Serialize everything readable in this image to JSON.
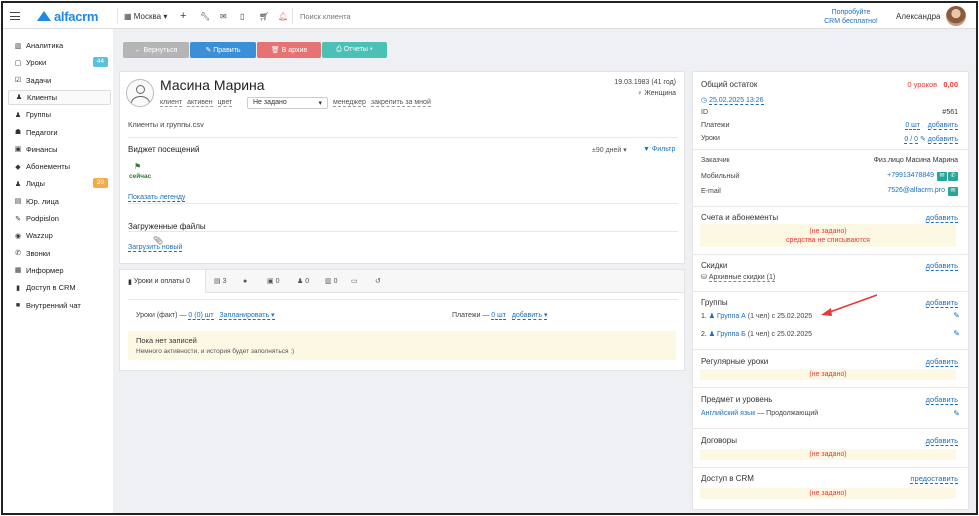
{
  "topbar": {
    "logo": "alfacrm",
    "city": "Москва",
    "search_placeholder": "Поиск клиента",
    "promo_line1": "Попробуйте",
    "promo_line2": "CRM бесплатно!",
    "user_name": "Александра"
  },
  "sidebar": {
    "items": [
      {
        "label": "Аналитика",
        "icon": "chart-icon"
      },
      {
        "label": "Уроки",
        "icon": "calendar-icon",
        "badge": "44",
        "badge_color": "#5bc0de"
      },
      {
        "label": "Задачи",
        "icon": "tasks-icon"
      },
      {
        "label": "Клиенты",
        "icon": "user-icon"
      },
      {
        "label": "Группы",
        "icon": "users-icon"
      },
      {
        "label": "Педагоги",
        "icon": "teacher-icon"
      },
      {
        "label": "Финансы",
        "icon": "money-icon"
      },
      {
        "label": "Абонементы",
        "icon": "tag-icon"
      },
      {
        "label": "Лиды",
        "icon": "leads-icon",
        "badge": "20",
        "badge_color": "#f0ad4e"
      },
      {
        "label": "Юр. лица",
        "icon": "building-icon"
      },
      {
        "label": "Podpislon",
        "icon": "sign-icon"
      },
      {
        "label": "Wazzup",
        "icon": "whatsapp-icon"
      },
      {
        "label": "Звонки",
        "icon": "phone-icon"
      },
      {
        "label": "Информер",
        "icon": "informer-icon"
      },
      {
        "label": "Доступ в CRM",
        "icon": "lock-icon"
      },
      {
        "label": "Внутренний чат",
        "icon": "chat-icon"
      }
    ]
  },
  "actions": {
    "back": "← Вернуться",
    "edit": "✎ Править",
    "archive": "🗑 В архив",
    "reports": "⎙ Отчеты ▾"
  },
  "client": {
    "name": "Масина Марина",
    "birthdate": "19.03.1983 (41 год)",
    "gender": "♀ Женщина",
    "tag_client": "клиент",
    "tag_active": "активен",
    "tag_color": "цвет",
    "select_value": "Не задано",
    "manager": "менеджер",
    "pin": "закрепить за мной",
    "note": "Клиенты и группы.csv"
  },
  "widget": {
    "title": "Виджет посещений",
    "period": "±90 дней ▾",
    "filter": "Фильтр",
    "now_label": "сейчас",
    "legend_link": "Показать легенду"
  },
  "files": {
    "title": "Загруженные файлы",
    "upload": "Загрузить новый"
  },
  "tabs": {
    "lessons": "Уроки и оплаты 0",
    "t2": "3",
    "t4": "0",
    "t5": "0",
    "t6": "0"
  },
  "lessons_panel": {
    "fact_label": "Уроки (факт) —",
    "fact_value": "0 (0) шт",
    "plan_link": "Запланировать ▾",
    "payments_label": "Платежи —",
    "payments_value": "0 шт",
    "add_link": "добавить ▾",
    "empty_title": "Пока нет записей",
    "empty_sub": "Немного активности, и история будет заполняться :)"
  },
  "right": {
    "balance_label": "Общий остаток",
    "balance_value": "0 уроков",
    "balance_money": "0,00",
    "date_link": "25.02.2025 13:26",
    "id_label": "ID",
    "id_value": "#561",
    "payments_label": "Платежи",
    "payments_value": "0 шт",
    "lessons_label": "Уроки",
    "lessons_value": "0 / 0",
    "add": "добавить",
    "customer_label": "Заказчик",
    "customer_value": "Физ.лицо Масина Марина",
    "mobile_label": "Мобильный",
    "mobile_value": "+79913478849",
    "email_label": "E-mail",
    "email_value": "7526@alfacrm.pro",
    "accounts_title": "Счета и абонементы",
    "not_set": "(не задано)",
    "not_charged": "средства не списываются",
    "discounts_title": "Скидки",
    "archive_discounts": "Архивные скидки (1)",
    "groups_title": "Группы",
    "group1_num": "1.",
    "group1_name": "Группа А",
    "group1_info": "(1 чел) с 25.02.2025",
    "group2_num": "2.",
    "group2_name": "Группа Б",
    "group2_info": "(1 чел) с 25.02.2025",
    "regular_title": "Регулярные уроки",
    "subject_title": "Предмет и уровень",
    "subject_link": "Английский язык",
    "subject_level": "— Продолжающий",
    "contracts_title": "Договоры",
    "access_title": "Доступ в CRM",
    "provide": "предоставить"
  },
  "colors": {
    "accent": "#1e88e5",
    "btn_back": "#b5b5b5",
    "btn_edit": "#3a8fd8",
    "btn_archive": "#e57373",
    "btn_reports": "#4dc0b5",
    "arrow": "#e53935"
  }
}
